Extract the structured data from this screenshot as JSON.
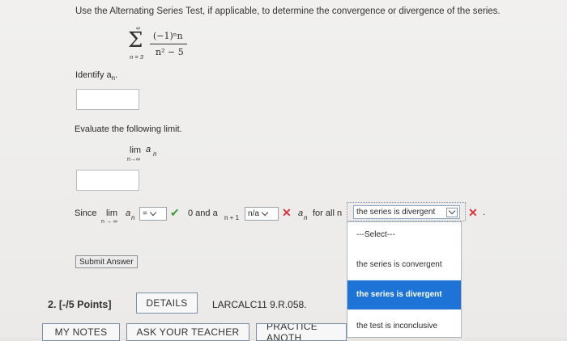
{
  "instruction": "Use the Alternating Series Test, if applicable, to determine the convergence or divergence of the series.",
  "series": {
    "upper": "∞",
    "lower": "n = 3",
    "numerator": "(−1)ⁿn",
    "denominator": "n² − 5"
  },
  "identify": {
    "label": "Identify a",
    "label_sub": "n",
    "label_end": ".",
    "answer": ""
  },
  "evaluate": {
    "label": "Evaluate the following limit.",
    "lim_word": "lim",
    "lim_sub": "n→∞",
    "lim_a": "a",
    "lim_n": "n",
    "answer": ""
  },
  "since_row": {
    "since": "Since",
    "lim_word": "lim",
    "lim_sub": "n → ∞",
    "a": "a",
    "n": "n",
    "select1_value": "=",
    "text_zero_and": "0 and a",
    "sub_n_plus_1": "n + 1",
    "select2_value": "n/a",
    "a2": "a",
    "n2": "n",
    "for_all": "for all n",
    "select3_value": "the series is divergent"
  },
  "dropdown": {
    "options": [
      {
        "label": "---Select---",
        "highlighted": false
      },
      {
        "label": "the series is convergent",
        "highlighted": false
      },
      {
        "label": "the series is divergent",
        "highlighted": true
      },
      {
        "label": "the test is inconclusive",
        "highlighted": false
      }
    ]
  },
  "submit_label": "Submit Answer",
  "question2": {
    "number": "2. [-/5 Points]",
    "details_label": "DETAILS",
    "ref": "LARCALC11 9.R.058.",
    "my_notes": "MY NOTES",
    "ask_teacher": "ASK YOUR TEACHER",
    "practice": "PRACTICE ANOTH"
  },
  "colors": {
    "correct": "#3a9a3a",
    "incorrect": "#d9363a",
    "highlight": "#1e74d6"
  }
}
